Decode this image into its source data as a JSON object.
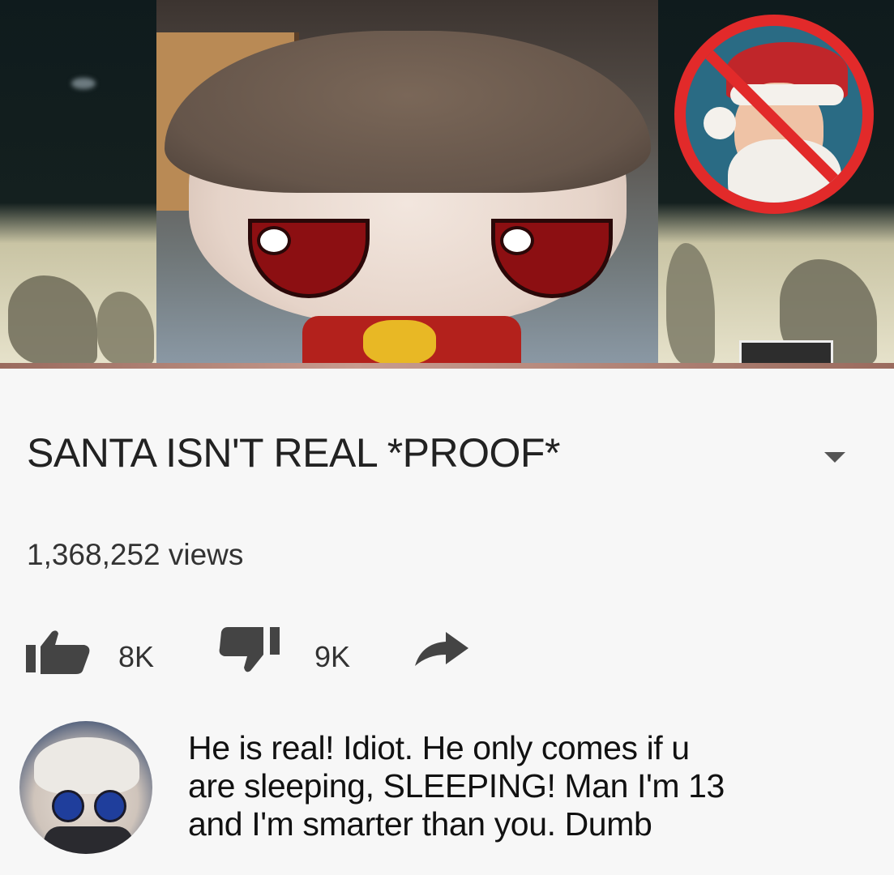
{
  "video": {
    "title": "SANTA ISN'T REAL *PROOF*",
    "views": "1,368,252 views",
    "likes": "8K",
    "dislikes": "9K"
  },
  "icons": {
    "expand": "chevron-down-icon",
    "like": "thumbs-up-icon",
    "dislike": "thumbs-down-icon",
    "share": "share-arrow-icon"
  },
  "comment": {
    "lines": [
      "He is real! Idiot. He only comes if u",
      "are sleeping, SLEEPING! Man I'm 13",
      "and I'm smarter than you. Dumb"
    ]
  },
  "colors": {
    "no_symbol_red": "#e22a2a",
    "text_dark": "#222222",
    "background": "#f7f7f7"
  }
}
